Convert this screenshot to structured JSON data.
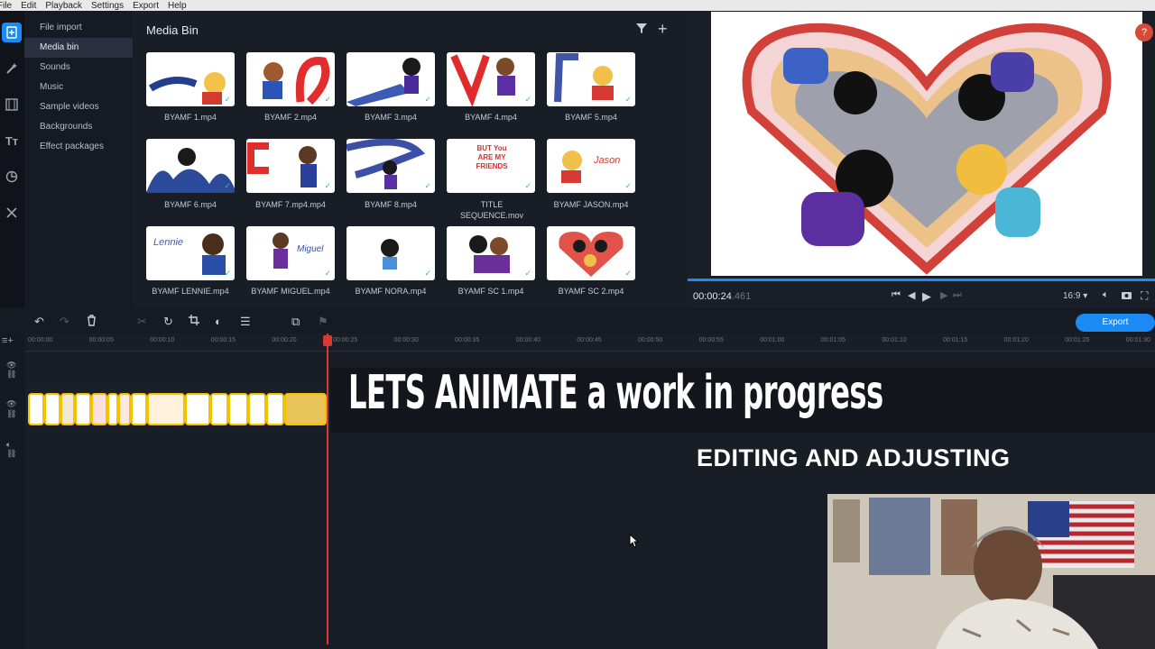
{
  "menubar": {
    "items": [
      "File",
      "Edit",
      "Playback",
      "Settings",
      "Export",
      "Help"
    ]
  },
  "leftrail": {
    "icons": [
      "import-icon",
      "magic-wand-icon",
      "film-transitions-icon",
      "titles-icon",
      "sticker-icon",
      "tools-icon"
    ]
  },
  "categories": [
    "File import",
    "Media bin",
    "Sounds",
    "Music",
    "Sample videos",
    "Backgrounds",
    "Effect packages"
  ],
  "media": {
    "title": "Media Bin",
    "items": [
      {
        "label": "BYAMF 1.mp4"
      },
      {
        "label": "BYAMF 2.mp4"
      },
      {
        "label": "BYAMF 3.mp4"
      },
      {
        "label": "BYAMF 4.mp4"
      },
      {
        "label": "BYAMF 5.mp4"
      },
      {
        "label": "BYAMF 6.mp4"
      },
      {
        "label": "BYAMF 7.mp4.mp4"
      },
      {
        "label": "BYAMF 8.mp4"
      },
      {
        "label": "TITLE SEQUENCE.mov",
        "thumb_text": "BUT You ARE MY FRIENDS"
      },
      {
        "label": "BYAMF JASON.mp4",
        "thumb_text": "Jason"
      },
      {
        "label": "BYAMF LENNIE.mp4",
        "thumb_text": "Lennie"
      },
      {
        "label": "BYAMF MIGUEL.mp4",
        "thumb_text": "Miguel"
      },
      {
        "label": "BYAMF NORA.mp4"
      },
      {
        "label": "BYAMF SC 1.mp4"
      },
      {
        "label": "BYAMF SC 2.mp4"
      }
    ]
  },
  "preview": {
    "help": "?",
    "timecode": "00:00:24",
    "timecode_ms": ".461",
    "aspect": "16:9 ▾"
  },
  "toolbar": {
    "export_label": "Export"
  },
  "ruler": {
    "ticks": [
      "00:00:00",
      "00:00:05",
      "00:00:10",
      "00:00:15",
      "00:00:20",
      "00:00:25",
      "00:00:30",
      "00:00:35",
      "00:00:40",
      "00:00:45",
      "00:00:50",
      "00:00:55",
      "00:01:00",
      "00:01:05",
      "00:01:10",
      "00:01:15",
      "00:01:20",
      "00:01:25",
      "00:01:30"
    ]
  },
  "overlay": {
    "title": "LETS ANIMATE a work in progress",
    "subtitle": "EDITING AND ADJUSTING"
  },
  "colors": {
    "accent": "#1b8af5",
    "playhead": "#d73a35",
    "clip_border": "#f3c300",
    "background": "#191d26"
  }
}
